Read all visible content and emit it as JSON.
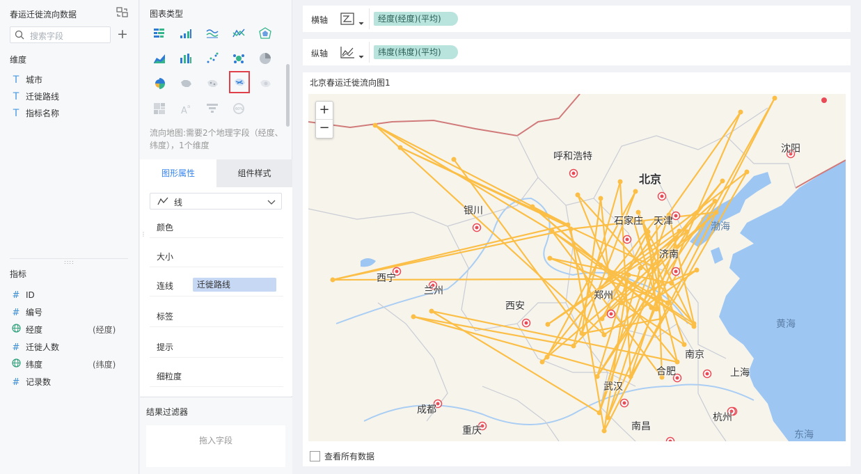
{
  "data_panel": {
    "title": "春运迁徙流向数据",
    "search_placeholder": "搜索字段",
    "dimensions_label": "维度",
    "dimensions": [
      {
        "icon": "text-field-icon",
        "label": "城市"
      },
      {
        "icon": "text-field-icon",
        "label": "迁徙路线"
      },
      {
        "icon": "text-field-icon",
        "label": "指标名称"
      }
    ],
    "measures_label": "指标",
    "measures": [
      {
        "icon": "number-field-icon",
        "label": "ID",
        "suffix": ""
      },
      {
        "icon": "number-field-icon",
        "label": "编号",
        "suffix": ""
      },
      {
        "icon": "globe-field-icon",
        "label": "经度",
        "suffix": "(经度)"
      },
      {
        "icon": "number-field-icon",
        "label": "迁徙人数",
        "suffix": ""
      },
      {
        "icon": "globe-field-icon",
        "label": "纬度",
        "suffix": "(纬度)"
      },
      {
        "icon": "number-field-icon",
        "label": "记录数",
        "suffix": ""
      }
    ]
  },
  "chart_type_panel": {
    "title": "图表类型",
    "description": "流向地图:需要2个地理字段（经度、纬度），1个维度",
    "selected": "flow-map",
    "tabs": {
      "active": "图形属性",
      "inactive": "组件样式"
    },
    "mark_type": "线",
    "properties": {
      "color": "颜色",
      "size": "大小",
      "connect": "连线",
      "connect_field": "迁徙路线",
      "label": "标签",
      "tooltip": "提示",
      "granularity": "细粒度"
    },
    "filter_title": "结果过滤器",
    "filter_placeholder": "拖入字段"
  },
  "axes": {
    "x_label": "横轴",
    "x_field": "经度(经度)(平均)",
    "y_label": "纵轴",
    "y_field": "纬度(纬度)(平均)"
  },
  "chart": {
    "title": "北京春运迁徙流向图1",
    "show_all_label": "查看所有数据",
    "zoom_in": "+",
    "zoom_out": "−"
  },
  "map_labels": {
    "cities": [
      "沈阳",
      "呼和浩特",
      "北京",
      "天津",
      "银川",
      "石家庄",
      "济南",
      "西宁",
      "兰州",
      "西安",
      "郑州",
      "南京",
      "合肥",
      "上海",
      "武汉",
      "成都",
      "杭州",
      "南昌",
      "重庆"
    ],
    "seas": [
      "渤海",
      "黄海",
      "东海"
    ]
  },
  "colors": {
    "accent": "#3685f2",
    "flow_line": "#fbbf48",
    "sea": "#9dc6f2",
    "land": "#f7f4ec",
    "city_marker": "#e94b56",
    "axis_pill": "#b8e4dd"
  }
}
